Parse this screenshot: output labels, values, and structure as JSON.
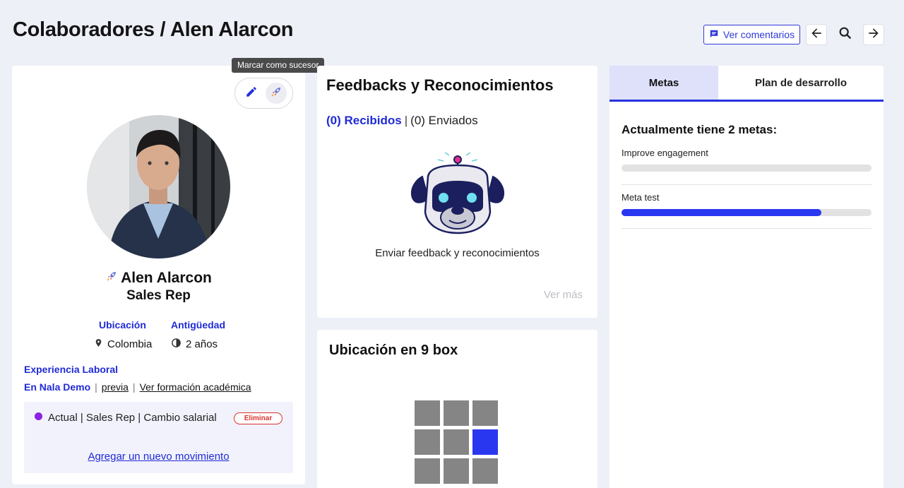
{
  "header": {
    "title": "Colaboradores / Alen Alarcon",
    "comments_label": "Ver comentarios"
  },
  "profile": {
    "tooltip": "Marcar como sucesor",
    "name": "Alen Alarcon",
    "role": "Sales Rep",
    "location_label": "Ubicación",
    "location_value": "Colombia",
    "seniority_label": "Antigüedad",
    "seniority_value": "2 años",
    "experience_label": "Experiencia Laboral",
    "experience_links": {
      "current": "En Nala Demo",
      "previous": "previa",
      "academic": "Ver formación académica"
    },
    "movement": {
      "text": "Actual | Sales Rep | Cambio salarial",
      "delete_label": "Eliminar",
      "dot_color": "#8a24e2"
    },
    "add_movement_label": "Agregar un nuevo movimiento"
  },
  "feedback": {
    "title": "Feedbacks y Reconocimientos",
    "received": "(0) Recibidos",
    "separator": "|",
    "sent": "(0) Enviados",
    "cta": "Enviar feedback y reconocimientos",
    "more": "Ver más"
  },
  "ninebox": {
    "title": "Ubicación en 9 box",
    "active_row": 1,
    "active_col": 2,
    "active_color": "#2a37f0"
  },
  "goals": {
    "tabs": [
      "Metas",
      "Plan de desarrollo"
    ],
    "active_tab": 0,
    "summary": "Actualmente tiene 2 metas:",
    "items": [
      {
        "name": "Improve engagement",
        "progress": 0
      },
      {
        "name": "Meta test",
        "progress": 0.8
      }
    ]
  },
  "colors": {
    "accent": "#1f2bd6",
    "danger": "#d8342f"
  }
}
